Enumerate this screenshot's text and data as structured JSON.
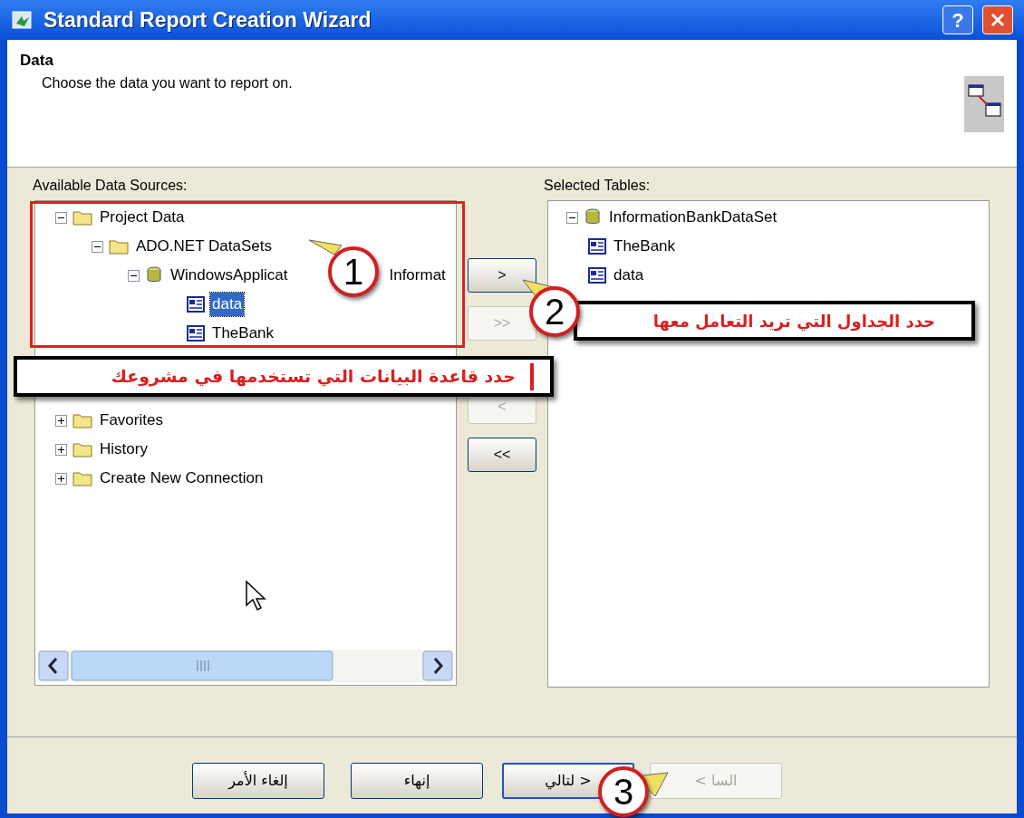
{
  "window": {
    "title": "Standard Report Creation Wizard",
    "help_button": "?"
  },
  "header": {
    "title": "Data",
    "subtitle": "Choose the data you want to report on."
  },
  "available": {
    "label": "Available Data Sources:",
    "tree": [
      {
        "label": "Project Data",
        "kind": "folder",
        "expanded": true,
        "selected": false,
        "children": [
          {
            "label": "ADO.NET DataSets",
            "kind": "folder",
            "expanded": true,
            "selected": false,
            "children": [
              {
                "label": "WindowsApplicat",
                "label_after": "Informat",
                "kind": "dataset",
                "expanded": true,
                "selected": false,
                "children": [
                  {
                    "label": "data",
                    "kind": "table",
                    "selected": true
                  },
                  {
                    "label": "TheBank",
                    "kind": "table",
                    "selected": false
                  }
                ]
              }
            ]
          }
        ]
      },
      {
        "label": "Favorites",
        "kind": "folder",
        "expanded": false,
        "selected": false
      },
      {
        "label": "History",
        "kind": "folder",
        "expanded": false,
        "selected": false
      },
      {
        "label": "Create New Connection",
        "kind": "folder",
        "expanded": false,
        "selected": false
      }
    ]
  },
  "transfer_buttons": [
    {
      "label": ">",
      "disabled": false
    },
    {
      "label": ">>",
      "disabled": true
    },
    {
      "label": "<",
      "disabled": true
    },
    {
      "label": "<<",
      "disabled": false
    }
  ],
  "selected_tables": {
    "label": "Selected Tables:",
    "tree": [
      {
        "label": "InformationBankDataSet",
        "kind": "dataset",
        "expanded": true,
        "selected": false,
        "children": [
          {
            "label": "TheBank",
            "kind": "table",
            "selected": false
          },
          {
            "label": "data",
            "kind": "table",
            "selected": false
          }
        ]
      }
    ]
  },
  "footer_buttons": [
    {
      "label": "< السا",
      "disabled": true,
      "default": false
    },
    {
      "label": "لتالي >",
      "disabled": false,
      "default": true
    },
    {
      "label": "إنهاء",
      "disabled": false,
      "default": false
    },
    {
      "label": "إلغاء الأمر",
      "disabled": false,
      "default": false
    }
  ],
  "callouts": [
    {
      "number": "1"
    },
    {
      "number": "2"
    },
    {
      "number": "3"
    }
  ],
  "notes": [
    {
      "text": "حدد قاعدة البيانات التي تستخدمها في مشروعك"
    },
    {
      "text": "حدد الجداول التي تريد التعامل معها"
    }
  ]
}
